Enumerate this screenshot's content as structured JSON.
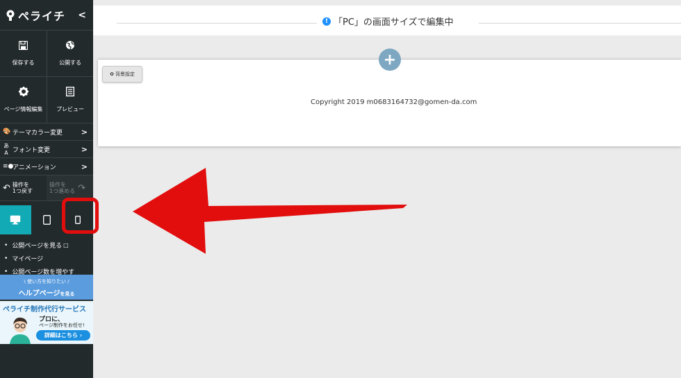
{
  "sidebar": {
    "logo_text": "ペライチ",
    "collapse_icon": "chevron-left-icon",
    "actions_row1": [
      {
        "label": "保存する",
        "icon": "floppy-disk-icon"
      },
      {
        "label": "公開する",
        "icon": "globe-icon"
      }
    ],
    "actions_row2": [
      {
        "label": "ページ情報編集",
        "icon": "gear-icon"
      },
      {
        "label": "プレビュー",
        "icon": "document-icon"
      }
    ],
    "menu": [
      {
        "label": "テーマカラー変更",
        "icon": "palette-icon"
      },
      {
        "label": "フォント変更",
        "icon": "font-icon"
      },
      {
        "label": "アニメーション",
        "icon": "animation-icon"
      }
    ],
    "undo": {
      "line1": "操作を",
      "line2": "1つ戻す"
    },
    "redo": {
      "line1": "操作を",
      "line2": "1つ進める"
    },
    "devices": [
      "desktop",
      "tablet",
      "smartphone"
    ],
    "links": [
      "公開ページを見る",
      "マイページ",
      "公開ページ数を増やす"
    ],
    "help": {
      "line1": "\\ 使い方を知りたい /",
      "line2": "ヘルプページ",
      "suffix": "を見る"
    },
    "ad": {
      "title": "ペライチ制作代行サービス",
      "line1": "プロに、",
      "line2": "ページ制作をお任せ!",
      "button": "詳細はこちら"
    }
  },
  "header": {
    "notice": "「PC」の画面サイズで編集中"
  },
  "canvas": {
    "bg_button_label": "背景設定",
    "copyright": "Copyright 2019 m0683164732@gomen-da.com"
  },
  "colors": {
    "sidebar_bg": "#232a2c",
    "accent_teal": "#12aab5",
    "highlight_red": "#e20d0d",
    "help_blue": "#5a9cde"
  }
}
